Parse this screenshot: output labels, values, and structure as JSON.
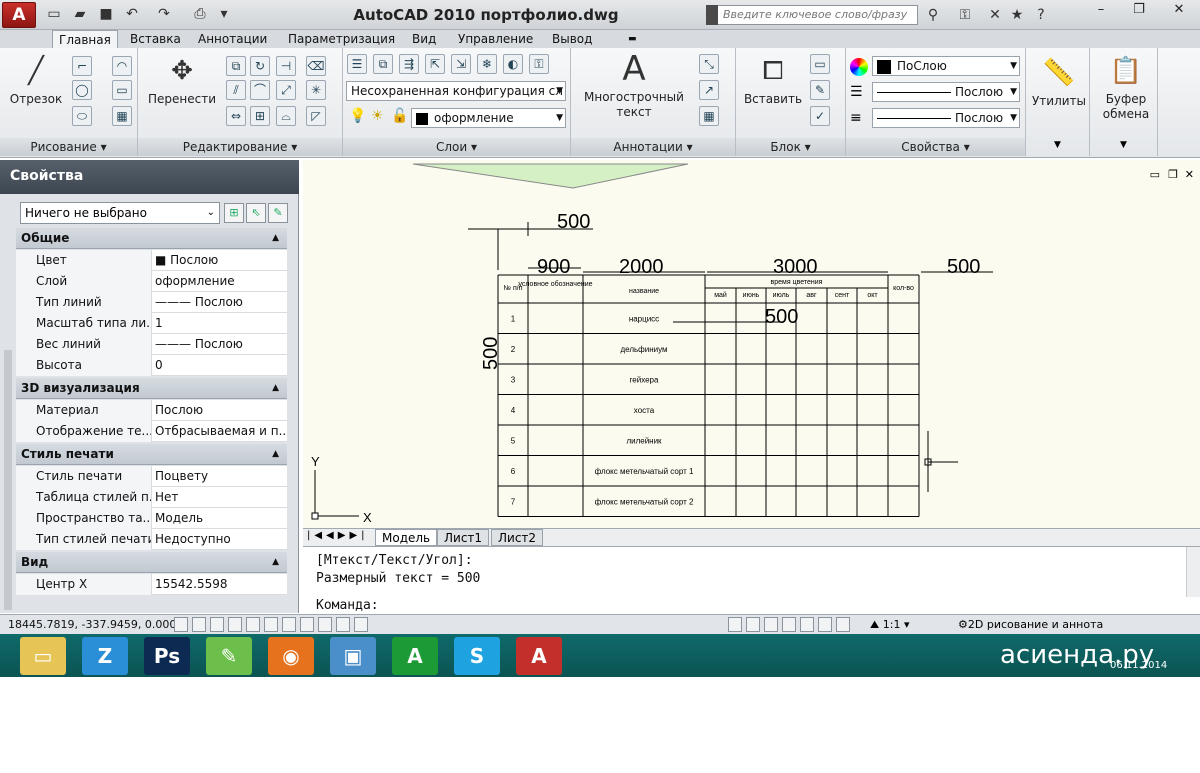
{
  "titlebar": {
    "app_letter": "A",
    "title": "AutoCAD 2010      портфолио.dwg",
    "search_placeholder": "Введите ключевое слово/фразу",
    "quick_access": [
      "new-icon",
      "open-icon",
      "save-icon",
      "undo-icon",
      "redo-icon",
      "plot-icon"
    ],
    "window_buttons": [
      "–",
      "❐",
      "✕"
    ]
  },
  "tabs": [
    "Главная",
    "Вставка",
    "Аннотации",
    "Параметризация",
    "Вид",
    "Управление",
    "Вывод"
  ],
  "ribbon": {
    "draw": {
      "title": "Рисование",
      "line_label": "Отрезок"
    },
    "modify": {
      "title": "Редактирование",
      "move_label": "Перенести"
    },
    "layers": {
      "title": "Слои",
      "state_combo": "Несохраненная конфигурация сл",
      "layer_combo": "оформление"
    },
    "annotation": {
      "title": "Аннотации",
      "mtext_label": "Многострочный текст"
    },
    "block": {
      "title": "Блок",
      "insert_label": "Вставить"
    },
    "properties": {
      "title": "Свойства",
      "color": "ПоСлою",
      "linetype": "Послою",
      "lineweight": "Послою"
    },
    "utilities": {
      "label": "Утилиты"
    },
    "clipboard": {
      "label": "Буфер обмена"
    }
  },
  "properties_palette": {
    "title": "Свойства",
    "selection": "Ничего не выбрано",
    "sections": [
      {
        "name": "Общие",
        "rows": [
          {
            "k": "Цвет",
            "v": "■ Послою"
          },
          {
            "k": "Слой",
            "v": "оформление"
          },
          {
            "k": "Тип линий",
            "v": "——— Послою"
          },
          {
            "k": "Масштаб типа ли...",
            "v": "1"
          },
          {
            "k": "Вес линий",
            "v": "——— Послою"
          },
          {
            "k": "Высота",
            "v": "0"
          }
        ]
      },
      {
        "name": "3D визуализация",
        "rows": [
          {
            "k": "Материал",
            "v": "Послою"
          },
          {
            "k": "Отображение те...",
            "v": "Отбрасываемая и п..."
          }
        ]
      },
      {
        "name": "Стиль печати",
        "rows": [
          {
            "k": "Стиль печати",
            "v": "Поцвету"
          },
          {
            "k": "Таблица стилей п...",
            "v": "Нет"
          },
          {
            "k": "Пространство та...",
            "v": "Модель"
          },
          {
            "k": "Тип стилей печати",
            "v": "Недоступно"
          }
        ]
      },
      {
        "name": "Вид",
        "rows": [
          {
            "k": "Центр X",
            "v": "15542.5598"
          }
        ]
      }
    ]
  },
  "drawing": {
    "dims": {
      "top": "500",
      "left": "500",
      "col1": "900",
      "col2": "2000",
      "col3": "3000",
      "col4": "500",
      "inner": "500"
    },
    "table": {
      "headers": [
        "№ п/п",
        "условное обозначение",
        "название",
        "время цветения",
        "кол-во"
      ],
      "months": [
        "май",
        "июнь",
        "июль",
        "авг",
        "сент",
        "окт"
      ],
      "rows": [
        {
          "n": "1",
          "name": "нарцисс"
        },
        {
          "n": "2",
          "name": "дельфиниум"
        },
        {
          "n": "3",
          "name": "гейхера"
        },
        {
          "n": "4",
          "name": "хоста"
        },
        {
          "n": "5",
          "name": "лилейник"
        },
        {
          "n": "6",
          "name": "флокс метельчатый сорт 1"
        },
        {
          "n": "7",
          "name": "флокс метельчатый сорт 2"
        }
      ]
    },
    "ucs": {
      "x": "X",
      "y": "Y"
    }
  },
  "layout_tabs": [
    "Модель",
    "Лист1",
    "Лист2"
  ],
  "command": {
    "lines": [
      "[Мтекст/Текст/Угол]:",
      "Размерный текст = 500"
    ],
    "prompt": "Команда:"
  },
  "statusbar": {
    "coords": "18445.7819, -337.9459, 0.0000",
    "scale": "1:1",
    "workspace": "2D рисование и аннота"
  },
  "taskbar": {
    "apps": [
      "explorer",
      "zoner",
      "photoshop",
      "notepad",
      "firefox",
      "photos",
      "autocad-green",
      "skype",
      "autocad"
    ],
    "app_glyphs": [
      "▭",
      "Z",
      "Ps",
      "✎",
      "◉",
      "▣",
      "A",
      "S",
      "A"
    ],
    "app_colors": [
      "#e6c455",
      "#2a8fd6",
      "#0d2a52",
      "#6cbf4a",
      "#e6721d",
      "#4a8fc9",
      "#1c9a36",
      "#1ea3e0",
      "#c3302b"
    ],
    "date": "06.11.2014"
  },
  "watermark": "асиенда.ру"
}
